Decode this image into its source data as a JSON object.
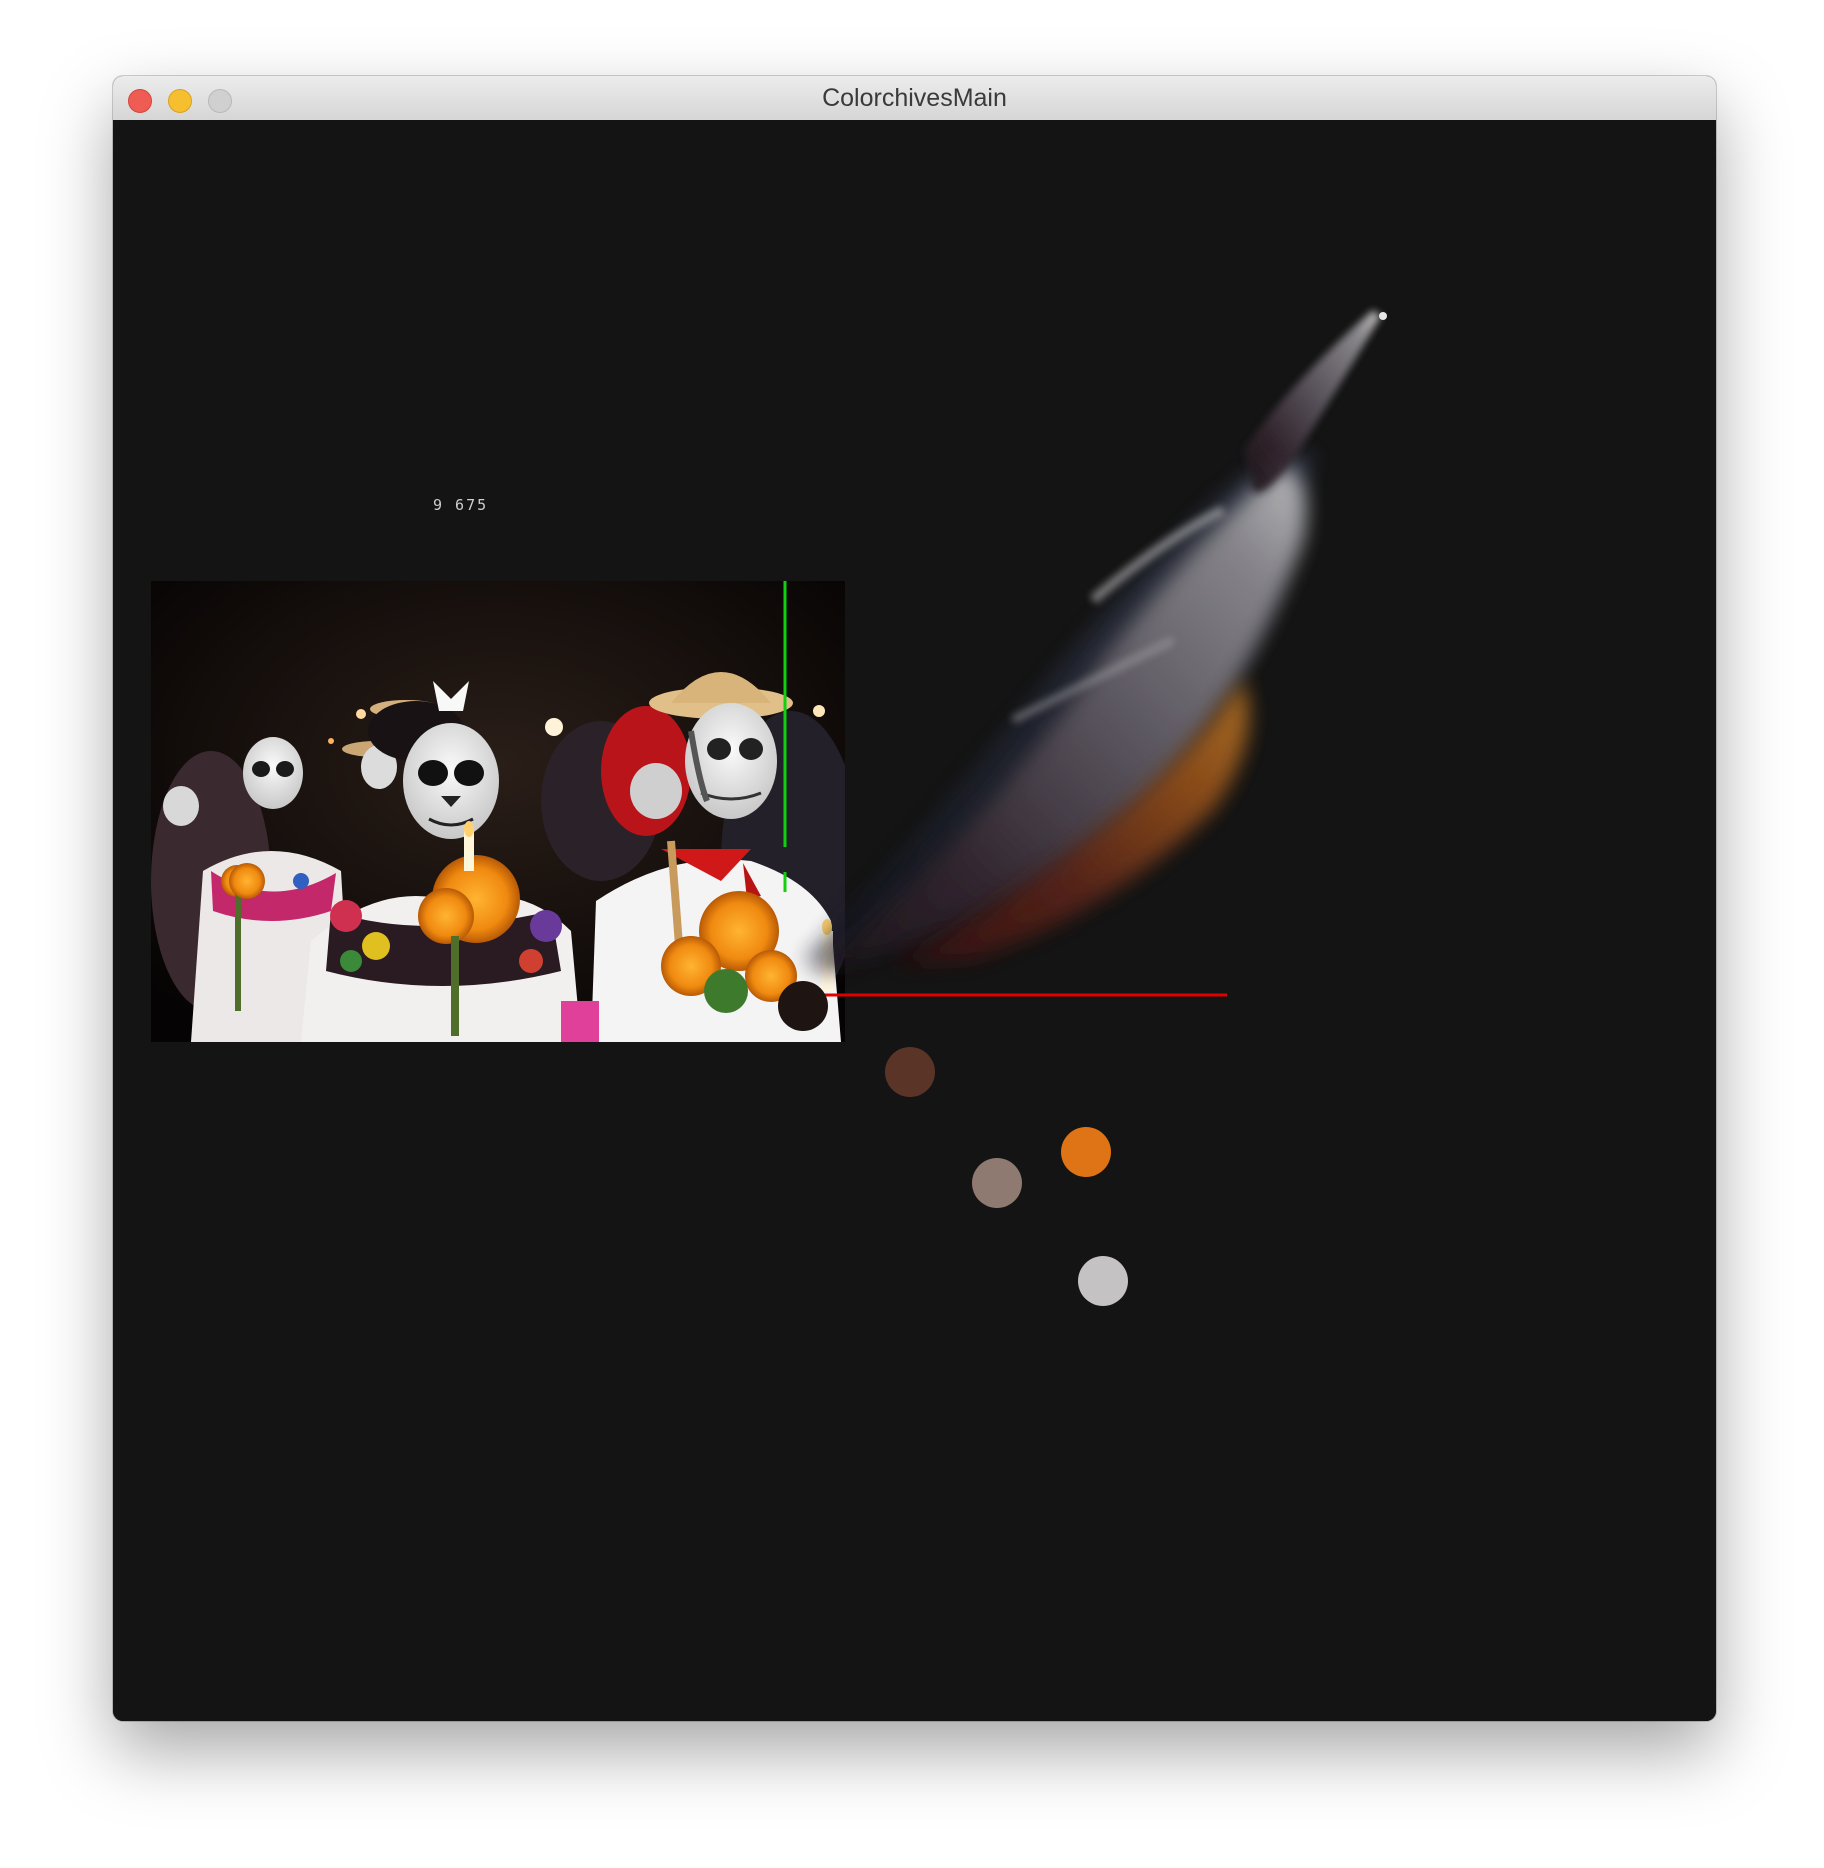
{
  "window": {
    "title": "ColorchivesMain"
  },
  "canvas": {
    "counter_text": "9 675",
    "background_color": "#141414"
  },
  "photo": {
    "subject": "Day of the Dead procession: people with skull face paint holding orange marigolds and candles at night"
  },
  "color_plot": {
    "x_axis_color": "#e00000",
    "y_axis_color": "#00d000",
    "cluster_swatches": [
      {
        "name": "near-black",
        "color": "#1e1412"
      },
      {
        "name": "dark-brown",
        "color": "#5a3426"
      },
      {
        "name": "taupe",
        "color": "#8e7a70"
      },
      {
        "name": "marigold-orange",
        "color": "#de7416"
      },
      {
        "name": "light-gray",
        "color": "#c4c2c2"
      }
    ]
  },
  "icons": {
    "close": "close-icon",
    "minimize": "minimize-icon",
    "maximize": "maximize-icon"
  }
}
